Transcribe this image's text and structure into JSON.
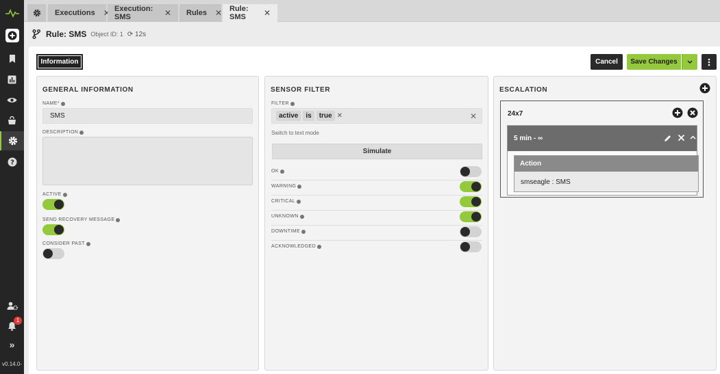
{
  "app": {
    "version": "v0.14.0-",
    "notification_count": "1",
    "accent_color": "#95c93d"
  },
  "tabs": [
    {
      "label": "Executions"
    },
    {
      "label": "Execution: SMS"
    },
    {
      "label": "Rules"
    },
    {
      "label": "Rule: SMS"
    }
  ],
  "header": {
    "title": "Rule: SMS",
    "object_id": "Object ID: 1",
    "refresh": "12s"
  },
  "toolbar": {
    "information": "Information",
    "cancel": "Cancel",
    "save": "Save Changes"
  },
  "general": {
    "title": "GENERAL INFORMATION",
    "name_label": "NAME*",
    "name_value": "SMS",
    "description_label": "DESCRIPTION",
    "description_value": "",
    "active_label": "ACTIVE",
    "active": true,
    "recovery_label": "SEND RECOVERY MESSAGE",
    "recovery": true,
    "consider_past_label": "CONSIDER PAST",
    "consider_past": false
  },
  "sensor": {
    "title": "SENSOR FILTER",
    "filter_label": "FILTER",
    "filter_chips": [
      "active",
      "is",
      "true"
    ],
    "text_mode": "Switch to text mode",
    "simulate": "Simulate",
    "states": [
      {
        "label": "OK",
        "on": false
      },
      {
        "label": "WARNING",
        "on": true
      },
      {
        "label": "CRITICAL",
        "on": true
      },
      {
        "label": "UNKNOWN",
        "on": true
      },
      {
        "label": "DOWNTIME",
        "on": false
      },
      {
        "label": "ACKNOWLEDGED",
        "on": false
      }
    ]
  },
  "escalation": {
    "title": "ESCALATION",
    "schedule": "24x7",
    "step": "5 min - ∞",
    "action_title": "Action",
    "action_value": "smseagle : SMS"
  }
}
